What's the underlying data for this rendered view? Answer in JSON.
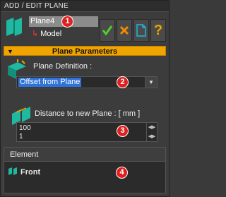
{
  "window": {
    "title": "ADD / EDIT PLANE"
  },
  "tree": {
    "selected_label": "Plane4",
    "child_label": "Model"
  },
  "toolbar": {
    "ok_icon": "check-icon",
    "cancel_icon": "cross-icon",
    "new_icon": "document-icon",
    "help_label": "?"
  },
  "section": {
    "title": "Plane Parameters"
  },
  "plane_definition": {
    "label": "Plane Definition :",
    "selected": "Offset from Plane"
  },
  "distance": {
    "label": "Distance to new Plane : [ mm ]",
    "values": [
      "100",
      "1"
    ]
  },
  "element_table": {
    "header": "Element",
    "rows": [
      "Front"
    ]
  },
  "badges": [
    "1",
    "2",
    "3",
    "4"
  ],
  "colors": {
    "accent_orange": "#f0a400",
    "selection_blue": "#2f72d8",
    "badge_red": "#e02020",
    "icon_teal": "#1fb8a0",
    "ok_green": "#4cd12a",
    "cancel_orange": "#f08a00"
  }
}
